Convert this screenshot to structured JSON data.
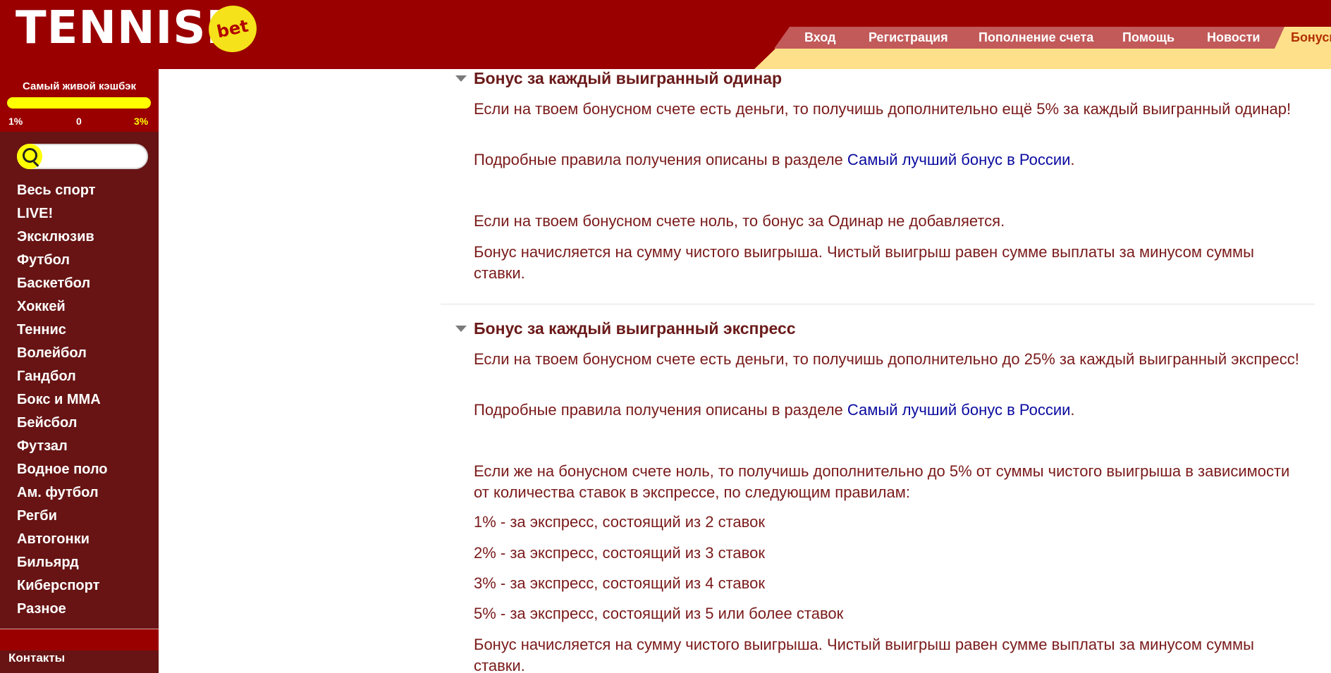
{
  "header": {
    "logo_text": "TENNISI",
    "logo_badge": "bet",
    "nav": [
      "Вход",
      "Регистрация",
      "Пополнение счета",
      "Помощь",
      "Новости"
    ],
    "nav_active": "Бонусы"
  },
  "sidebar": {
    "cashback": {
      "title": "Самый живой кэшбэк",
      "min": "1%",
      "current": "0",
      "max": "3%"
    },
    "search": {
      "placeholder": ""
    },
    "sports": [
      "Весь спорт",
      "LIVE!",
      "Эксклюзив",
      "Футбол",
      "Баскетбол",
      "Хоккей",
      "Теннис",
      "Волейбол",
      "Гандбол",
      "Бокс и ММА",
      "Бейсбол",
      "Футзал",
      "Водное поло",
      "Ам. футбол",
      "Регби",
      "Автогонки",
      "Бильярд",
      "Киберспорт",
      "Разное"
    ],
    "contacts": "Контакты"
  },
  "sections": [
    {
      "title": "Бонус за каждый выигранный одинар",
      "p1": "Если на твоем бонусном счете есть деньги, то получишь дополнительно ещё 5% за каждый выигранный одинар!",
      "rules_prefix": "Подробные правила получения описаны в разделе ",
      "rules_link": "Самый лучший бонус в России",
      "rules_suffix": ".",
      "p2": "Если на твоем бонусном счете ноль, то бонус за Одинар не добавляется.",
      "p3": "Бонус начисляется на сумму чистого выигрыша. Чистый выигрыш равен сумме выплаты за минусом суммы ставки."
    },
    {
      "title": "Бонус за каждый выигранный экспресс",
      "p1": "Если на твоем бонусном счете есть деньги, то получишь дополнительно до 25% за каждый выигранный экспресс!",
      "rules_prefix": "Подробные правила получения описаны в разделе ",
      "rules_link": "Самый лучший бонус в России",
      "rules_suffix": ".",
      "p2": "Если же на бонусном счете ноль, то получишь дополнительно до 5% от суммы чистого выигрыша в зависимости от количества ставок в экспрессе, по следующим правилам:",
      "tiers": [
        "1% - за экспресс, состоящий из 2 ставок",
        "2% - за экспресс, состоящий из 3 ставок",
        "3% - за экспресс, состоящий из 4 ставок",
        "5% - за экспресс, состоящий из 5 или более ставок"
      ],
      "p3": "Бонус начисляется на сумму чистого выигрыша. Чистый выигрыш равен сумме выплаты за минусом суммы ставки."
    }
  ],
  "colors": {
    "brand_red": "#9a0000",
    "sidebar": "#681414",
    "accent_yellow": "#ffff00",
    "text": "#7a1a1a",
    "link": "#0a0aa0"
  }
}
